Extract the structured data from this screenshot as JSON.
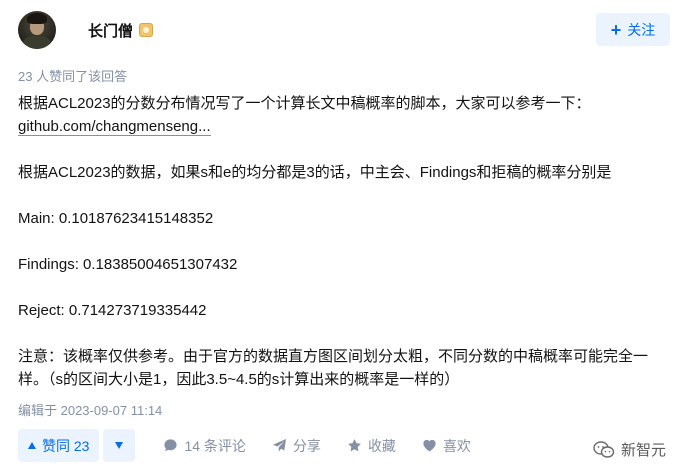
{
  "author": {
    "name": "长门僧",
    "follow_label": "关注"
  },
  "upvote_note": "23 人赞同了该回答",
  "content": {
    "line1": "根据ACL2023的分数分布情况写了一个计算长文中稿概率的脚本，大家可以参考一下：",
    "link": "github.com/changmenseng...",
    "line3": "根据ACL2023的数据，如果s和e的均分都是3的话，中主会、Findings和拒稿的概率分别是",
    "main": "Main: 0.10187623415148352",
    "findings": "Findings: 0.18385004651307432",
    "reject": "Reject: 0.714273719335442",
    "note_line1": "注意：该概率仅供参考。由于官方的数据直方图区间划分太粗，不同分数的中稿概率可能完全一",
    "note_line2": "样。（s的区间大小是1，因此3.5~4.5的s计算出来的概率是一样的）"
  },
  "edited": "编辑于 2023-09-07 11:14",
  "actions": {
    "vote_up": "赞同 23",
    "comments": "14 条评论",
    "share": "分享",
    "favorite": "收藏",
    "like": "喜欢"
  },
  "watermark": "新智元",
  "colors": {
    "brand": "#056de8",
    "brand_bg": "#ebf3ff",
    "meta": "#8590a6"
  }
}
